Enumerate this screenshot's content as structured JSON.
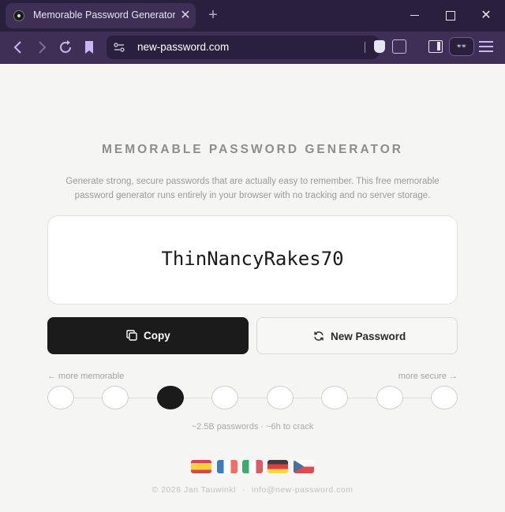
{
  "browser": {
    "tab_title": "Memorable Password Generator",
    "tab_close": "✕",
    "new_tab": "+",
    "url": "new-password.com",
    "win_close": "✕",
    "vpn_label": "👓"
  },
  "page": {
    "title": "MEMORABLE PASSWORD GENERATOR",
    "description": "Generate strong, secure passwords that are actually easy to remember. This free memorable password generator runs entirely in your browser with no tracking and no server storage.",
    "password": "ThinNancyRakes70",
    "copy_label": "Copy",
    "new_password_label": "New Password",
    "hint_left": "← more memorable",
    "hint_right": "more secure →",
    "slider": {
      "steps": 8,
      "selected_index": 2
    },
    "stats": "~2.5B passwords · ~6h to crack",
    "languages": [
      "es",
      "fr",
      "it",
      "de",
      "cz"
    ],
    "footer_copyright": "© 2026 Jan Tauwinkl",
    "footer_sep": "·",
    "footer_email": "info@new-password.com"
  },
  "icons": {
    "copy": "copy-icon",
    "refresh": "refresh-icon"
  }
}
